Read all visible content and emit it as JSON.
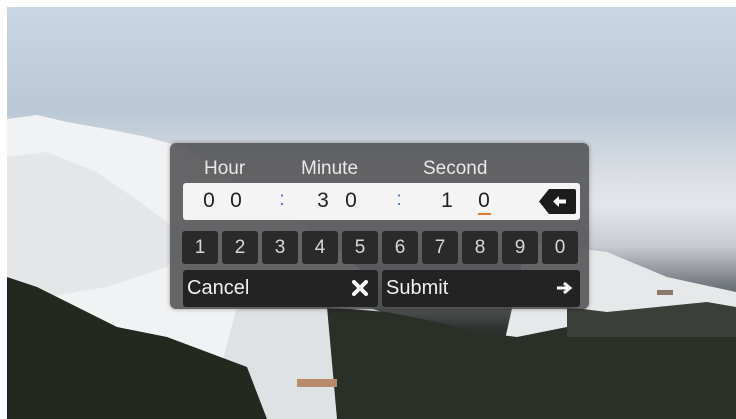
{
  "labels": {
    "hour": "Hour",
    "minute": "Minute",
    "second": "Second"
  },
  "time": {
    "h1": "0",
    "h2": "0",
    "sep1": ":",
    "m1": "3",
    "m2": "0",
    "sep2": ":",
    "s1": "1",
    "s2": "0"
  },
  "keypad": [
    "1",
    "2",
    "3",
    "4",
    "5",
    "6",
    "7",
    "8",
    "9",
    "0"
  ],
  "actions": {
    "cancel": "Cancel",
    "submit": "Submit"
  },
  "icons": {
    "backspace": "backspace-arrow-icon",
    "cancel": "close-x-icon",
    "submit": "arrow-right-icon"
  },
  "colors": {
    "separator": "#4a6fd4",
    "cursor": "#e07c2a"
  }
}
